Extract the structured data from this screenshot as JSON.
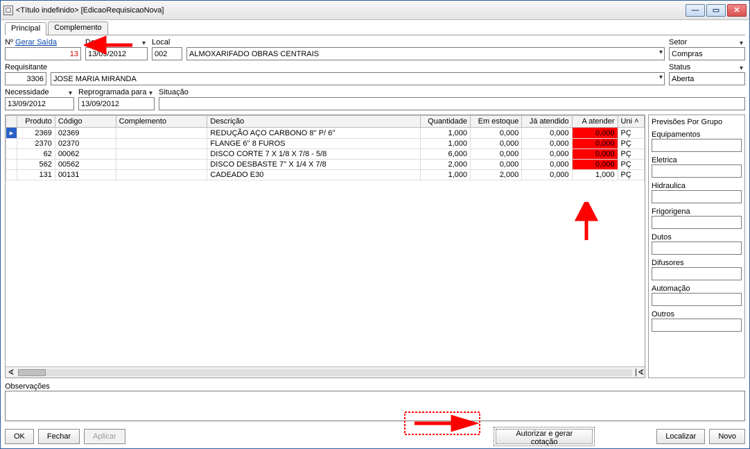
{
  "window": {
    "title": "<Título indefinido> [EdicaoRequisicaoNova]"
  },
  "tabs": {
    "principal": "Principal",
    "complemento": "Complemento"
  },
  "form": {
    "numero_label": "Nº",
    "gerar_saida": "Gerar Saída",
    "numero_value": "13",
    "data_label": "Data",
    "data_value": "13/09/2012",
    "local_label": "Local",
    "local_codigo": "002",
    "local_nome": "ALMOXARIFADO OBRAS CENTRAIS",
    "setor_label": "Setor",
    "setor_value": "Compras",
    "requisitante_label": "Requisitante",
    "requisitante_codigo": "3306",
    "requisitante_nome": "JOSE MARIA MIRANDA",
    "status_label": "Status",
    "status_value": "Aberta",
    "necessidade_label": "Necessidade",
    "necessidade_value": "13/09/2012",
    "reprogramada_label": "Reprogramada para",
    "reprogramada_value": "13/09/2012",
    "situacao_label": "Situação",
    "situacao_value": ""
  },
  "grid": {
    "headers": {
      "produto": "Produto",
      "codigo": "Código",
      "complemento": "Complemento",
      "descricao": "Descrição",
      "quantidade": "Quantidade",
      "em_estoque": "Em estoque",
      "ja_atendido": "Já atendido",
      "a_atender": "A atender",
      "uni": "Uni"
    },
    "rows": [
      {
        "produto": "2369",
        "codigo": "02369",
        "complemento": "",
        "descricao": "REDUÇÃO AÇO CARBONO 8'' P/ 6''",
        "quantidade": "1,000",
        "em_estoque": "0,000",
        "ja_atendido": "0,000",
        "a_atender": "0,000",
        "uni": "PÇ",
        "red": true,
        "selected": true
      },
      {
        "produto": "2370",
        "codigo": "02370",
        "complemento": "",
        "descricao": "FLANGE 6'' 8 FUROS",
        "quantidade": "1,000",
        "em_estoque": "0,000",
        "ja_atendido": "0,000",
        "a_atender": "0,000",
        "uni": "PÇ",
        "red": true
      },
      {
        "produto": "62",
        "codigo": "00062",
        "complemento": "",
        "descricao": "DISCO CORTE 7 X 1/8 X 7/8  -  5/8",
        "quantidade": "6,000",
        "em_estoque": "0,000",
        "ja_atendido": "0,000",
        "a_atender": "0,000",
        "uni": "PÇ",
        "red": true
      },
      {
        "produto": "562",
        "codigo": "00562",
        "complemento": "",
        "descricao": "DISCO DESBASTE 7'' X 1/4 X 7/8",
        "quantidade": "2,000",
        "em_estoque": "0,000",
        "ja_atendido": "0,000",
        "a_atender": "0,000",
        "uni": "PÇ",
        "red": true
      },
      {
        "produto": "131",
        "codigo": "00131",
        "complemento": "",
        "descricao": "CADEADO E30",
        "quantidade": "1,000",
        "em_estoque": "2,000",
        "ja_atendido": "0,000",
        "a_atender": "1,000",
        "uni": "PÇ",
        "red": false
      }
    ]
  },
  "side": {
    "title": "Previsões Por Grupo",
    "groups": {
      "equipamentos": "Equipamentos",
      "eletrica": "Eletrica",
      "hidraulica": "Hidraulica",
      "frigorigena": "Frigorigena",
      "dutos": "Dutos",
      "difusores": "Difusores",
      "automacao": "Automação",
      "outros": "Outros"
    }
  },
  "observacoes": {
    "label": "Observações",
    "value": ""
  },
  "buttons": {
    "ok": "OK",
    "fechar": "Fechar",
    "aplicar": "Aplicar",
    "autorizar": "Autorizar e gerar cotação",
    "localizar": "Localizar",
    "novo": "Novo"
  }
}
